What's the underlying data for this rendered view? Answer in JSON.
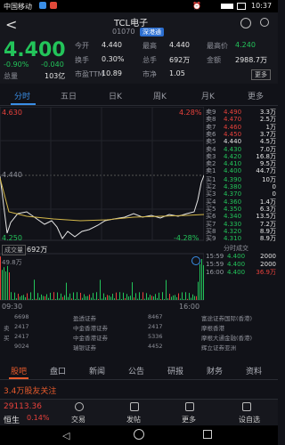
{
  "status": {
    "carrier": "中国移动",
    "time": "10:37"
  },
  "header": {
    "title": "TCL电子",
    "code": "01070",
    "tag": "深港通",
    "back": "<"
  },
  "quote": {
    "price": "4.400",
    "change_pct": "-0.90%",
    "change": "-0.040",
    "volume_label": "总量",
    "volume": "103亿",
    "metrics": [
      {
        "label": "今开",
        "value": "4.440"
      },
      {
        "label": "最高",
        "value": "4.440"
      },
      {
        "label": "最高价",
        "value": "4.240"
      },
      {
        "label": "换手",
        "value": "0.30%"
      },
      {
        "label": "总手",
        "value": "692万"
      },
      {
        "label": "金额",
        "value": "2988.7万"
      },
      {
        "label": "市盈TTM",
        "value": "10.89"
      },
      {
        "label": "市净",
        "value": "1.05"
      },
      {
        "label": "more",
        "value": "更多"
      }
    ]
  },
  "tabs": [
    "分时",
    "五日",
    "日K",
    "周K",
    "月K",
    "更多"
  ],
  "chart": {
    "price_high": "4.630",
    "price_mid": "4.440",
    "price_low": "4.250",
    "pct_high": "4.28%",
    "pct_low": "-4.28%",
    "volume_label": "成交量",
    "volume_value": "692万",
    "volume_max": "49.8万",
    "time_start": "09:30",
    "time_end": "16:00"
  },
  "book": {
    "asks": [
      {
        "label": "卖9",
        "price": "4.490",
        "vol": "3.3万",
        "color": "#e8413b"
      },
      {
        "label": "卖8",
        "price": "4.470",
        "vol": "2.5万",
        "color": "#e8413b"
      },
      {
        "label": "卖7",
        "price": "4.460",
        "vol": "1万",
        "color": "#e8413b"
      },
      {
        "label": "卖6",
        "price": "4.450",
        "vol": "3.7万",
        "color": "#e8413b"
      },
      {
        "label": "卖5",
        "price": "4.440",
        "vol": "4.5万",
        "color": "#e6e6e6"
      },
      {
        "label": "卖4",
        "price": "4.430",
        "vol": "7.0万",
        "color": "#23c45a"
      },
      {
        "label": "卖3",
        "price": "4.420",
        "vol": "16.8万",
        "color": "#23c45a"
      },
      {
        "label": "卖2",
        "price": "4.410",
        "vol": "9.5万",
        "color": "#23c45a"
      },
      {
        "label": "卖1",
        "price": "4.400",
        "vol": "44.7万",
        "color": "#23c45a"
      }
    ],
    "bids": [
      {
        "label": "买1",
        "price": "4.390",
        "vol": "10万",
        "color": "#23c45a"
      },
      {
        "label": "买2",
        "price": "4.380",
        "vol": "0",
        "color": "#23c45a"
      },
      {
        "label": "买3",
        "price": "4.370",
        "vol": "0",
        "color": "#23c45a"
      },
      {
        "label": "买4",
        "price": "4.360",
        "vol": "1.4万",
        "color": "#23c45a"
      },
      {
        "label": "买5",
        "price": "4.350",
        "vol": "6.3万",
        "color": "#23c45a"
      },
      {
        "label": "买6",
        "price": "4.340",
        "vol": "13.5万",
        "color": "#23c45a"
      },
      {
        "label": "买7",
        "price": "4.330",
        "vol": "7.2万",
        "color": "#23c45a"
      },
      {
        "label": "买8",
        "price": "4.320",
        "vol": "8.9万",
        "color": "#23c45a"
      },
      {
        "label": "买9",
        "price": "4.310",
        "vol": "8.9万",
        "color": "#23c45a"
      }
    ],
    "ticks_label": "分时成交",
    "ticks": [
      {
        "time": "15:59",
        "price": "4.400",
        "vol": "2000"
      },
      {
        "time": "15:59",
        "price": "4.400",
        "vol": "2000"
      },
      {
        "time": "16:00",
        "price": "4.400",
        "vol": "36.9万"
      }
    ]
  },
  "brokers": [
    {
      "left_label": "",
      "left_val": "6698",
      "name_a": "盈透证券",
      "val_a": "8467",
      "name_b": "富途证券国际(香港)",
      "side": ""
    },
    {
      "left_label": "卖",
      "left_val": "2417",
      "name_a": "中金香港证券",
      "val_a": "2417",
      "name_b": "摩根香港",
      "side": ""
    },
    {
      "left_label": "买",
      "left_val": "2417",
      "name_a": "中金香港证券",
      "val_a": "5336",
      "name_b": "摩根大通金融(香港)",
      "side": ""
    },
    {
      "left_label": "",
      "left_val": "9024",
      "name_a": "瑞银证券",
      "val_a": "4452",
      "name_b": "辉立证券亚洲",
      "side": ""
    }
  ],
  "bottom_tabs": [
    "股吧",
    "盘口",
    "新闻",
    "公告",
    "研报",
    "财务",
    "资料"
  ],
  "news": {
    "text": "3.4万股友关注"
  },
  "nav": {
    "index_name": "恒生",
    "index_value": "29113.36",
    "index_pct": "0.14%",
    "items": [
      "交易",
      "发帖",
      "更多",
      "设自选"
    ]
  }
}
